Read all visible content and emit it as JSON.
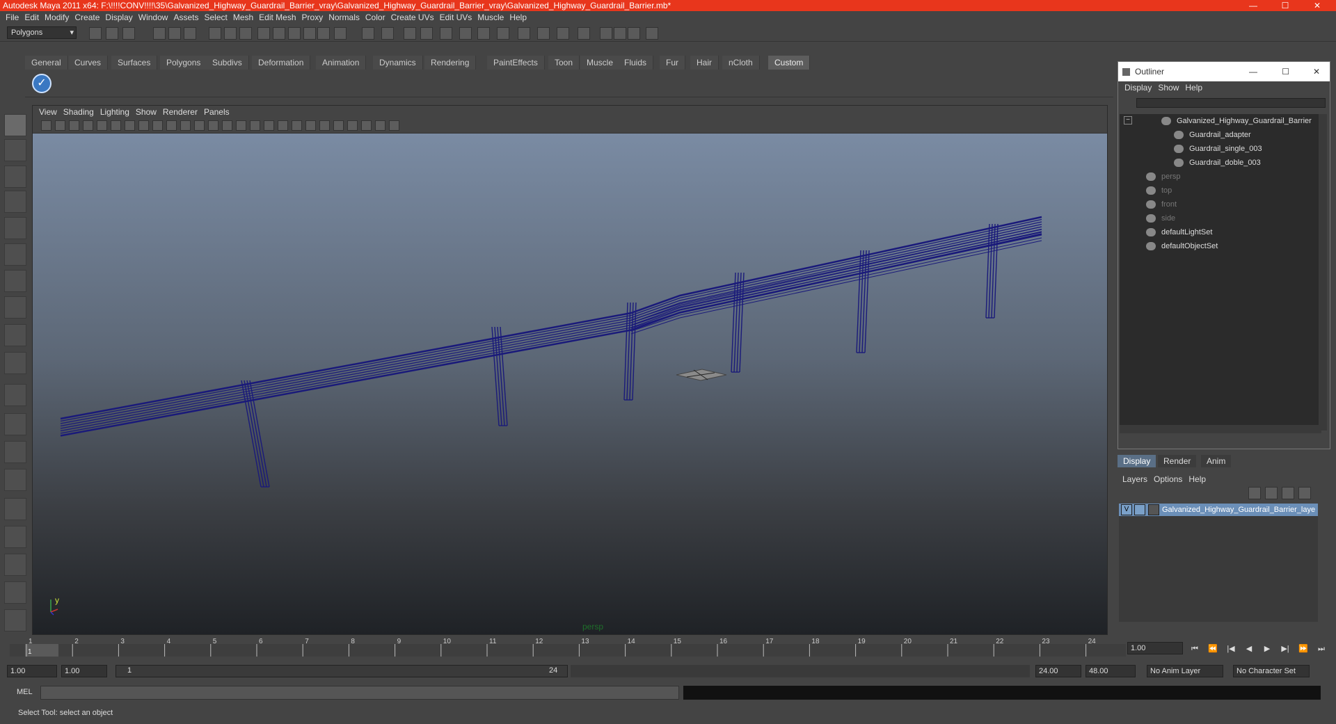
{
  "window": {
    "title": "Autodesk Maya 2011 x64: F:\\!!!!CONV!!!!\\35\\Galvanized_Highway_Guardrail_Barrier_vray\\Galvanized_Highway_Guardrail_Barrier_vray\\Galvanized_Highway_Guardrail_Barrier.mb*",
    "minimize": "—",
    "maximize": "☐",
    "close": "✕"
  },
  "menubar": [
    "File",
    "Edit",
    "Modify",
    "Create",
    "Display",
    "Window",
    "Assets",
    "Select",
    "Mesh",
    "Edit Mesh",
    "Proxy",
    "Normals",
    "Color",
    "Create UVs",
    "Edit UVs",
    "Muscle",
    "Help"
  ],
  "status_line": {
    "mode": "Polygons"
  },
  "shelf_tabs": [
    "General",
    "Curves",
    "Surfaces",
    "Polygons",
    "Subdivs",
    "Deformation",
    "Animation",
    "Dynamics",
    "Rendering",
    "PaintEffects",
    "Toon",
    "Muscle",
    "Fluids",
    "Fur",
    "Hair",
    "nCloth",
    "Custom"
  ],
  "shelf_active": "Custom",
  "panel_menu": [
    "View",
    "Shading",
    "Lighting",
    "Show",
    "Renderer",
    "Panels"
  ],
  "viewport": {
    "camera": "persp",
    "axis_y": "y",
    "axis_x": "x",
    "wire_color": "#1a1a7a"
  },
  "outliner": {
    "title": "Outliner",
    "menu": [
      "Display",
      "Show",
      "Help"
    ],
    "items": [
      {
        "label": "Galvanized_Highway_Guardrail_Barrier",
        "dim": false
      },
      {
        "label": "Guardrail_adapter",
        "dim": false
      },
      {
        "label": "Guardrail_single_003",
        "dim": false
      },
      {
        "label": "Guardrail_doble_003",
        "dim": false
      },
      {
        "label": "persp",
        "dim": true
      },
      {
        "label": "top",
        "dim": true
      },
      {
        "label": "front",
        "dim": true
      },
      {
        "label": "side",
        "dim": true
      },
      {
        "label": "defaultLightSet",
        "dim": false
      },
      {
        "label": "defaultObjectSet",
        "dim": false
      }
    ]
  },
  "layer_editor": {
    "tabs": [
      "Display",
      "Render",
      "Anim"
    ],
    "menu": [
      "Layers",
      "Options",
      "Help"
    ],
    "layer_visible": "V",
    "layer_name": "Galvanized_Highway_Guardrail_Barrier_layer"
  },
  "time_slider": {
    "ticks": [
      "1",
      "2",
      "3",
      "4",
      "5",
      "6",
      "7",
      "8",
      "9",
      "10",
      "11",
      "12",
      "13",
      "14",
      "15",
      "16",
      "17",
      "18",
      "19",
      "20",
      "21",
      "22",
      "23",
      "24"
    ],
    "current_frame_marker": "1",
    "current_time": "1.00"
  },
  "range": {
    "start": "1.00",
    "start2": "1.00",
    "range_start": "1",
    "range_end": "24",
    "end": "24.00",
    "end2": "48.00",
    "anim_layer": "No Anim Layer",
    "char_set": "No Character Set"
  },
  "command_line": {
    "label": "MEL"
  },
  "help_line": "Select Tool: select an object"
}
